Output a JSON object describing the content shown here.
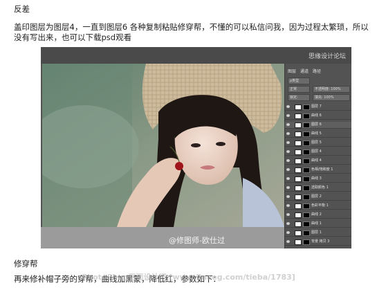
{
  "article": {
    "heading1": "反差",
    "paragraph1": "盖印图层为图层4，一直到图层6 各种复制粘贴修穿帮，不懂的可以私信问我，因为过程太繁琐，所以没有写出来，也可以下载psd观看",
    "heading2": "修穿帮",
    "paragraph2": "再来修补帽子旁的穿帮，曲线加黑蒙，降低红，参数如下："
  },
  "watermark": "PhotoShop平面设计吧 [www.lineeg.com/tieba/1783]",
  "photoshop": {
    "brand": "思缘设计论坛",
    "credit": "@修图师-欧仕过",
    "panel": {
      "tab1": "图层",
      "tab2": "通道",
      "tab3": "路径",
      "kind_label": "ρ类型",
      "mode_label": "正常",
      "opacity_label": "不透明度: 100%",
      "lock_label": "锁定:",
      "fill_label": "填充: 100%",
      "layers": [
        {
          "name": "图层 7"
        },
        {
          "name": "曲线 6"
        },
        {
          "name": "图层 6"
        },
        {
          "name": "曲线 5"
        },
        {
          "name": "图层 5"
        },
        {
          "name": "图层 4"
        },
        {
          "name": "曲线 4"
        },
        {
          "name": "色相/饱和度 1"
        },
        {
          "name": "曲线 3"
        },
        {
          "name": "选取颜色 1"
        },
        {
          "name": "图层 2"
        },
        {
          "name": "色彩平衡 1"
        },
        {
          "name": "曲线 2"
        },
        {
          "name": "曲线 1"
        },
        {
          "name": "图层 1"
        },
        {
          "name": "背景 拷贝 3"
        }
      ]
    }
  },
  "colors": {
    "text": "#222222",
    "ps_background": "#535353",
    "canvas_bg": "#6a7f74",
    "graybar": "#9b9b9b"
  }
}
